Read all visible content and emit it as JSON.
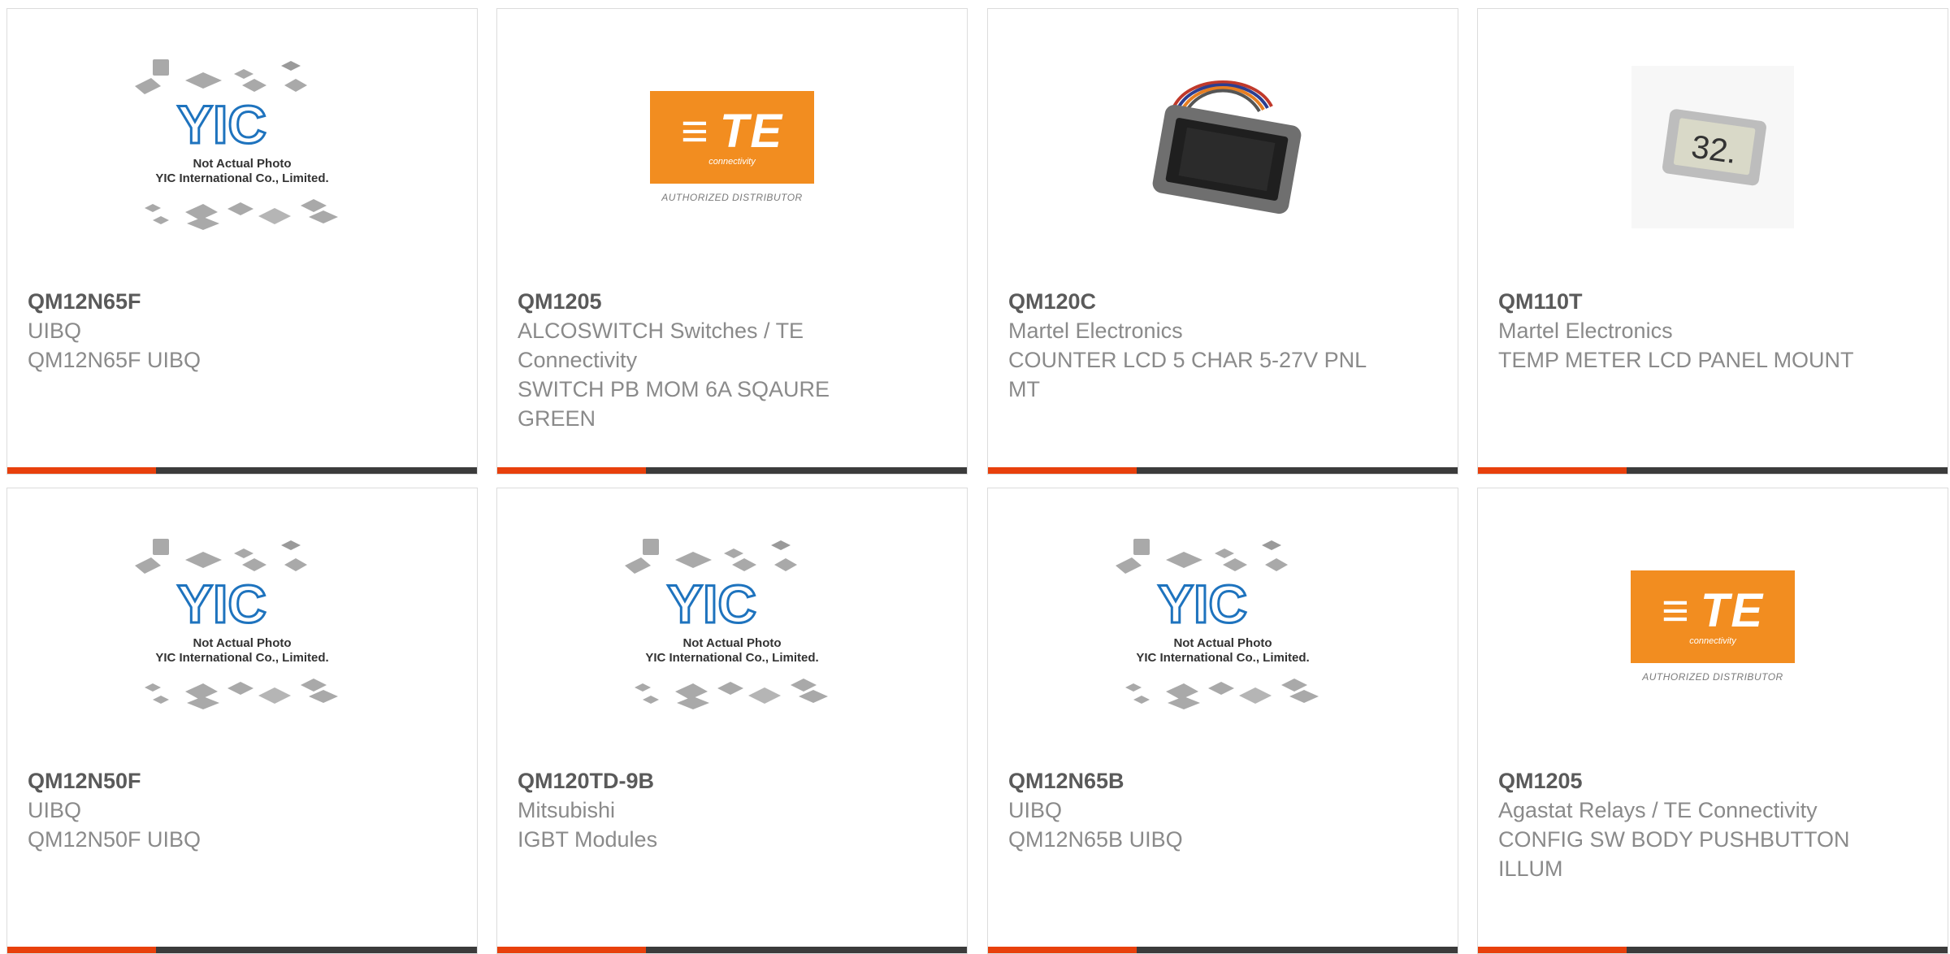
{
  "colors": {
    "accent": "#e8400c",
    "bar": "#3b3b3b",
    "te_orange": "#f28d20",
    "yic_blue": "#1e73be"
  },
  "placeholder": {
    "line1": "Not Actual Photo",
    "line2": "YIC International Co., Limited.",
    "logo_text": "YIC"
  },
  "te_logo": {
    "mark": "TE",
    "sub": "connectivity",
    "caption": "AUTHORIZED DISTRIBUTOR"
  },
  "products": [
    {
      "part": "QM12N65F",
      "manufacturer": "UIBQ",
      "description": "QM12N65F UIBQ",
      "image": "yic-placeholder"
    },
    {
      "part": "QM1205",
      "manufacturer": "ALCOSWITCH Switches / TE Connectivity",
      "description": "SWITCH PB MOM 6A SQAURE GREEN",
      "image": "te-logo"
    },
    {
      "part": "QM120C",
      "manufacturer": "Martel Electronics",
      "description": "COUNTER LCD 5 CHAR 5-27V PNL MT",
      "image": "lcd-counter-photo"
    },
    {
      "part": "QM110T",
      "manufacturer": "Martel Electronics",
      "description": "TEMP METER LCD PANEL MOUNT",
      "image": "temp-meter-photo",
      "display_reading": "32."
    },
    {
      "part": "QM12N50F",
      "manufacturer": "UIBQ",
      "description": "QM12N50F UIBQ",
      "image": "yic-placeholder"
    },
    {
      "part": "QM120TD-9B",
      "manufacturer": "Mitsubishi",
      "description": "IGBT Modules",
      "image": "yic-placeholder"
    },
    {
      "part": "QM12N65B",
      "manufacturer": "UIBQ",
      "description": "QM12N65B UIBQ",
      "image": "yic-placeholder"
    },
    {
      "part": "QM1205",
      "manufacturer": "Agastat Relays / TE Connectivity",
      "description": "CONFIG SW BODY PUSHBUTTON ILLUM",
      "image": "te-logo"
    }
  ]
}
